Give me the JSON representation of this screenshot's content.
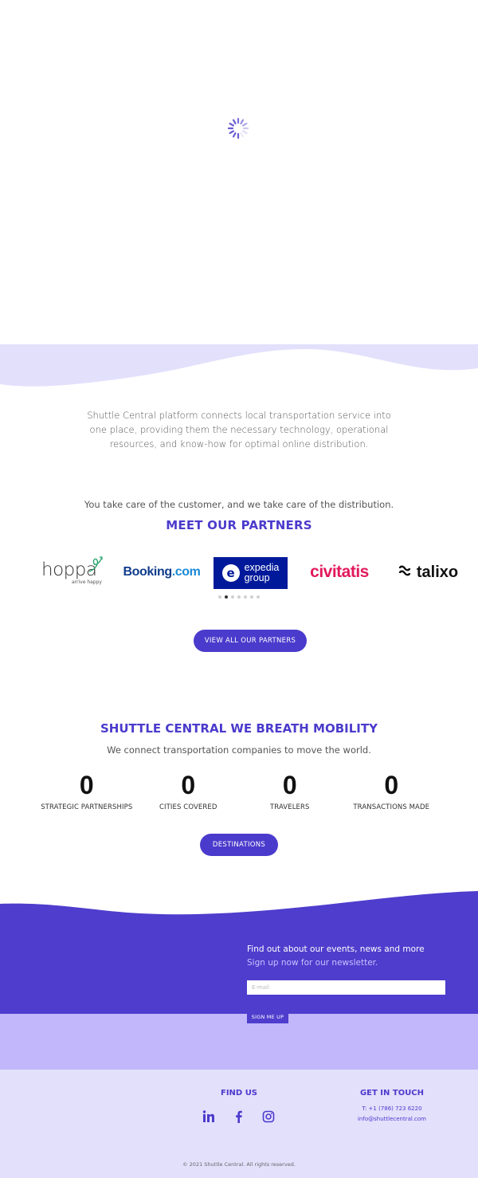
{
  "intro": {
    "line1": "Shuttle Central platform connects local transportation service into",
    "line2": "one place, providing them the necessary technology, operational",
    "line3": "resources, and know-how for optimal online distribution."
  },
  "partners": {
    "tagline": "You take care of the customer, and we take care of the distribution.",
    "title": "MEET OUR PARTNERS",
    "logos": {
      "hoppa": {
        "word": "hoppa",
        "sub": "arrive happy"
      },
      "booking": {
        "main": "Booking",
        "suffix": ".com"
      },
      "expedia": {
        "line1": "expedia",
        "line2": "group",
        "mark": "e"
      },
      "civitatis": "civitatis",
      "talixo": "talixo"
    },
    "slides_count": 7,
    "active_slide": 2,
    "button": "VIEW ALL OUR PARTNERS"
  },
  "mobility": {
    "title": "SHUTTLE CENTRAL WE BREATH MOBILITY",
    "subtitle": "We connect transportation companies to move the world.",
    "stats": [
      {
        "value": "0",
        "label": "STRATEGIC PARTNERSHIPS"
      },
      {
        "value": "0",
        "label": "CITIES COVERED"
      },
      {
        "value": "0",
        "label": "TRAVELERS"
      },
      {
        "value": "0",
        "label": "TRANSACTIONS MADE"
      }
    ],
    "button": "DESTINATIONS"
  },
  "newsletter": {
    "line1": "Find out about our events, news and more",
    "line2": "Sign up now for our newsletter.",
    "email_placeholder": "E-mail",
    "button": "SIGN ME UP"
  },
  "footer": {
    "find_us": "FIND US",
    "social_icons": [
      "linkedin-icon",
      "facebook-icon",
      "instagram-icon"
    ],
    "get_in_touch": "GET IN TOUCH",
    "phone": "T: +1 (786) 723 6220",
    "email": "info@shuttlecentral.com",
    "copyright": "© 2021 Shuttle Central. All rights reserved."
  },
  "colors": {
    "accent": "#4b3bcc",
    "wave_light": "#e3e0fc",
    "band_purple": "#4f3dcd",
    "band_lavender": "#c1b7fa"
  }
}
